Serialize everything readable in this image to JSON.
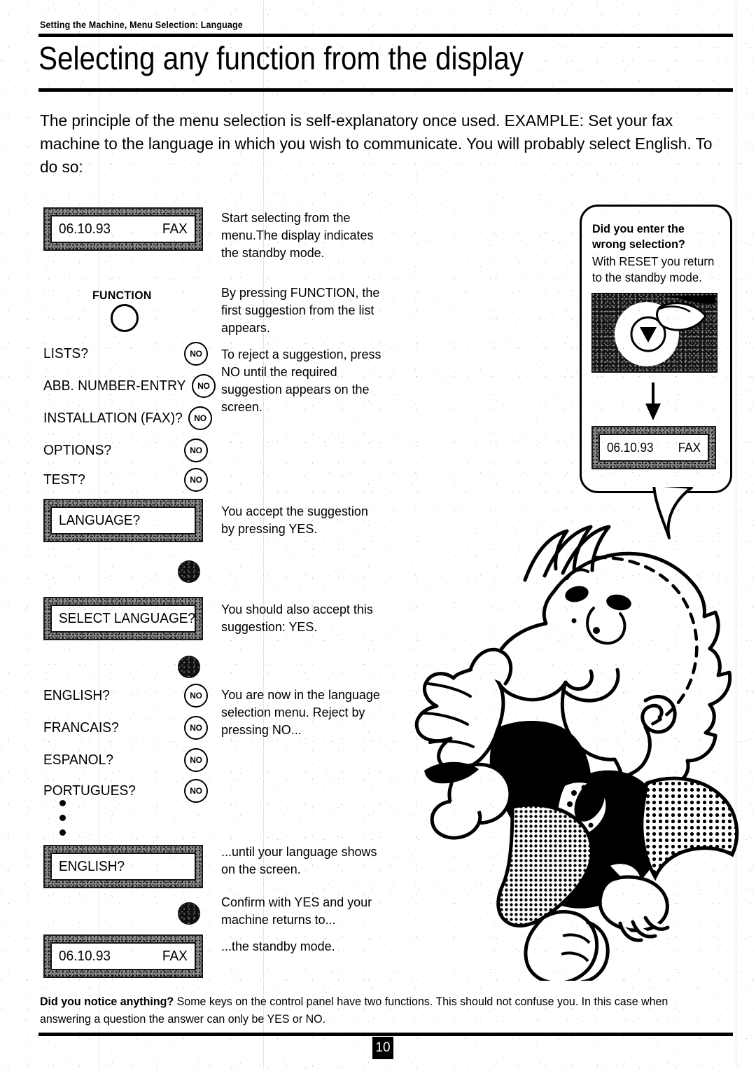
{
  "header": {
    "eyebrow": "Setting the Machine, Menu Selection: Language",
    "title": "Selecting any function from the display"
  },
  "intro": "The principle of the menu selection is self-explanatory once used. EXAMPLE: Set your fax machine to the language in which you wish to communicate. You will probably select English. To do so:",
  "displays": {
    "standby_top": {
      "left": "06.10.93",
      "right": "FAX"
    },
    "language_prompt": {
      "left": "LANGUAGE?",
      "right": ""
    },
    "select_language_prompt": {
      "left": "SELECT LANGUAGE?",
      "right": ""
    },
    "english_prompt": {
      "left": "ENGLISH?",
      "right": ""
    },
    "standby_bottom": {
      "left": "06.10.93",
      "right": "FAX"
    }
  },
  "function_key": {
    "label": "FUNCTION"
  },
  "menu_items": [
    {
      "label": "LISTS?",
      "key": "NO"
    },
    {
      "label": "ABB. NUMBER-ENTRY",
      "key": "NO"
    },
    {
      "label": "INSTALLATION (FAX)?",
      "key": "NO"
    },
    {
      "label": "OPTIONS?",
      "key": "NO"
    },
    {
      "label": "TEST?",
      "key": "NO"
    }
  ],
  "language_items": [
    {
      "label": "ENGLISH?",
      "key": "NO"
    },
    {
      "label": "FRANCAIS?",
      "key": "NO"
    },
    {
      "label": "ESPANOL?",
      "key": "NO"
    },
    {
      "label": "PORTUGUES?",
      "key": "NO"
    }
  ],
  "notes": [
    "Start selecting from the menu.The display indicates the standby mode.",
    "By pressing FUNCTION, the first suggestion from the list appears.",
    "To reject a suggestion, press NO until the required suggestion appears on the screen.",
    "You accept the suggestion by pressing YES.",
    "You should also accept this suggestion: YES.",
    "You are now in the language selection menu. Reject by pressing NO...",
    "...until your language shows on the screen.",
    "Confirm with YES and your machine returns to...",
    "...the standby mode."
  ],
  "callout": {
    "title": "Did you enter the wrong selection?",
    "body": "With RESET you return to the standby mode.",
    "display": {
      "left": "06.10.93",
      "right": "FAX"
    }
  },
  "footer": {
    "lead": "Did you notice anything?",
    "text": "Some keys on the control panel have two functions. This should not confuse you. In this case when answering a question the answer can only be YES or NO.",
    "page_number": "10"
  },
  "colors": {
    "ink": "#000000",
    "paper": "#ffffff",
    "lcd_bezel": "#8a8a8a"
  }
}
